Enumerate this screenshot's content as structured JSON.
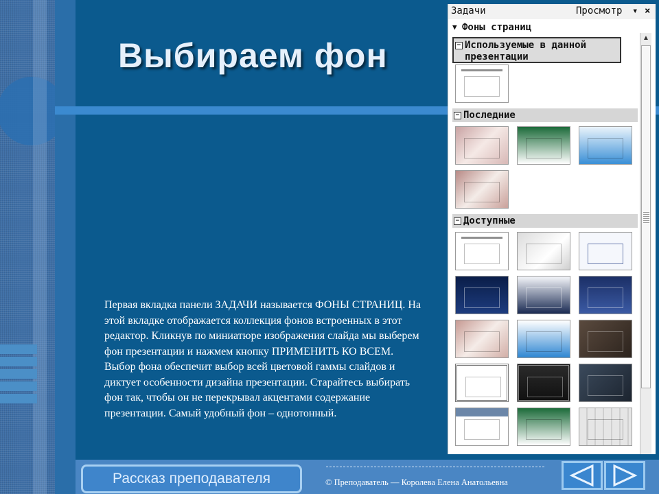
{
  "slide": {
    "title": "Выбираем фон",
    "body": "Первая вкладка панели ЗАДАЧИ называется ФОНЫ СТРАНИЦ. На этой вкладке отображается коллекция фонов встроенных в этот редактор. Кликнув по миниатюре изображения слайда мы выберем фон презентации и нажмем кнопку ПРИМЕНИТЬ КО ВСЕМ. Выбор фона обеспечит выбор всей цветовой гаммы слайдов и диктует особенности дизайна презентации. Старайтесь выбирать фон так, чтобы он не перекрывал акцентами содержание презентации. Самый удобный фон – однотонный."
  },
  "tasks_pane": {
    "title": "Задачи",
    "view_menu": "Просмотр",
    "view_arrow": "▾",
    "close": "×",
    "page_backgrounds": "Фоны страниц",
    "sections": {
      "used": "Используемые в данной презентации",
      "recent": "Последние",
      "available": "Доступные"
    }
  },
  "footer": {
    "story_button": "Рассказ преподавателя",
    "separator": "------------------------------------------------------------",
    "copyright": "© Преподаватель — Королева Елена Анатольевна"
  },
  "colors": {
    "background": "#0b5a8e",
    "accent": "#3b8ad0",
    "title_text": "#e6f0fb"
  },
  "icons": {
    "prev": "triangle-left-icon",
    "next": "triangle-right-icon",
    "expand": "triangle-down-icon",
    "collapse": "minus-box-icon"
  }
}
